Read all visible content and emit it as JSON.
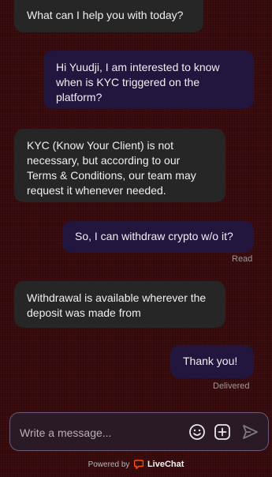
{
  "messages": [
    {
      "from": "agent",
      "text": "What can I help you with today?"
    },
    {
      "from": "visitor",
      "text": "Hi Yuudji, I am interested to know when is KYC triggered on the platform?"
    },
    {
      "from": "agent",
      "text": "KYC (Know Your Client) is not necessary, but according to our Terms & Conditions, our team may request it whenever needed."
    },
    {
      "from": "visitor",
      "text": "So, I can withdraw crypto w/o it?",
      "status": "Read"
    },
    {
      "from": "agent",
      "text": "Withdrawal is available wherever the deposit was made from"
    },
    {
      "from": "visitor",
      "text": "Thank you!",
      "status": "Delivered"
    }
  ],
  "composer": {
    "placeholder": "Write a message...",
    "icons": [
      "emoji-icon",
      "add-attachment-icon",
      "send-icon"
    ]
  },
  "footer": {
    "powered_by": "Powered by",
    "brand": "LiveChat",
    "brand_color": "#ff5100"
  }
}
